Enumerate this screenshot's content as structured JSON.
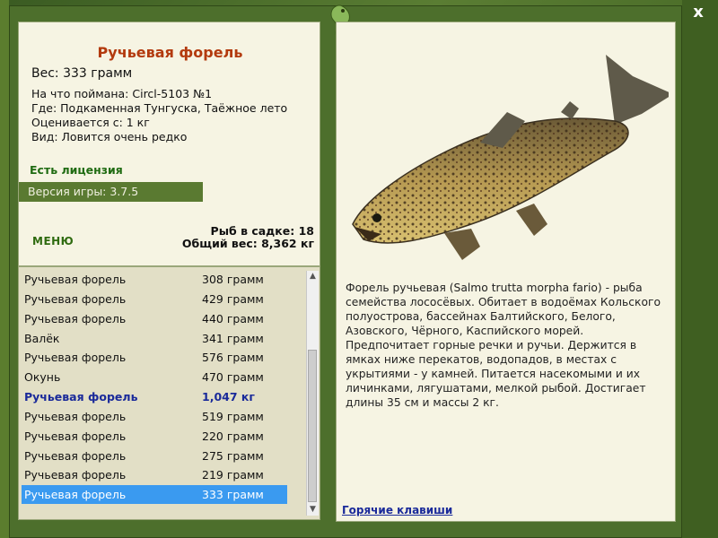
{
  "fish": {
    "title": "Ручьевая форель",
    "weight": "Вес: 333 грамм",
    "caught_on": "На что поймана: Circl-5103 №1",
    "location": "Где: Подкаменная Тунгуска, Таёжное лето",
    "value": "Оценивается с: 1 кг",
    "rarity": "Вид: Ловится очень редко"
  },
  "license": "Есть лицензия",
  "version": "Версия игры: 3.7.5",
  "menu_label": "МЕНЮ",
  "totals": {
    "fish_count": "Рыб в садке: 18",
    "total_weight": "Общий вес: 8,362 кг"
  },
  "catch_list": [
    {
      "name": "Ручьевая форель",
      "weight": "308 грамм"
    },
    {
      "name": "Ручьевая форель",
      "weight": "429 грамм"
    },
    {
      "name": "Ручьевая форель",
      "weight": "440 грамм"
    },
    {
      "name": "Валёк",
      "weight": "341 грамм"
    },
    {
      "name": "Ручьевая форель",
      "weight": "576 грамм"
    },
    {
      "name": "Окунь",
      "weight": "470 грамм"
    },
    {
      "name": "Ручьевая форель",
      "weight": "1,047 кг"
    },
    {
      "name": "Ручьевая форель",
      "weight": "519 грамм"
    },
    {
      "name": "Ручьевая форель",
      "weight": "220 грамм"
    },
    {
      "name": "Ручьевая форель",
      "weight": "275 грамм"
    },
    {
      "name": "Ручьевая форель",
      "weight": "219 грамм"
    },
    {
      "name": "Ручьевая форель",
      "weight": "333 грамм"
    }
  ],
  "description": "Форель ручьевая (Salmo trutta morpha fario) - рыба семейства лососёвых. Обитает в водоёмах Кольского полуострова, бассейнах Балтийского, Белого, Азовского, Чёрного, Каспийского морей. Предпочитает горные речки и ручьи. Держится в ямках ниже перекатов, водопадов, в местах с укрытиями - у камней. Питается насекомыми и их личинками, лягушатами, мелкой рыбой. Достигает длины 35 см и массы 2 кг.",
  "hotkeys_label": "Горячие клавиши",
  "close_label": "x",
  "icons": {
    "close": "close-icon",
    "logo": "lizard-logo-icon",
    "fish": "trout-image",
    "scroll_up": "scroll-up-icon",
    "scroll_down": "scroll-down-icon"
  },
  "colors": {
    "title": "#b33a0e",
    "license": "#1f6b12",
    "highlight": "#1a2a9a",
    "selection": "#3a9af0",
    "frame": "#4d6f2c"
  }
}
